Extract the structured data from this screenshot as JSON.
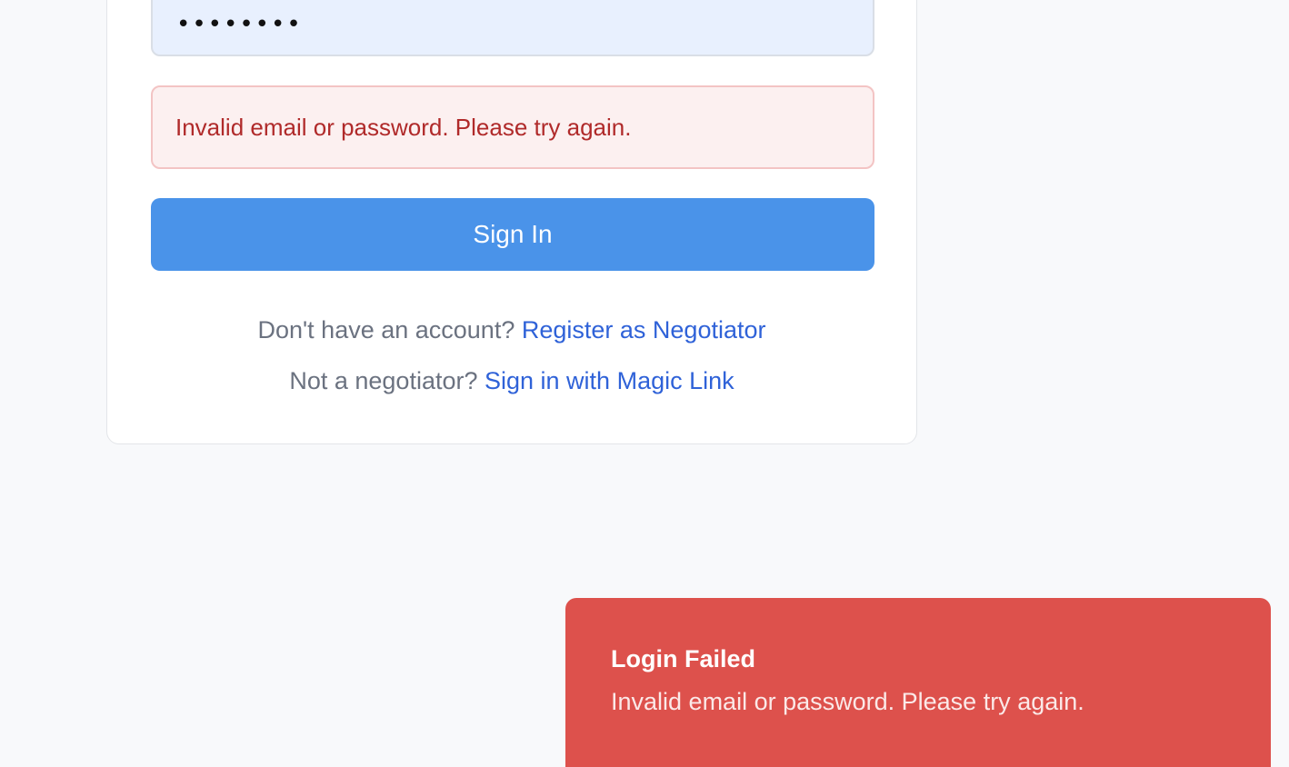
{
  "login_form": {
    "password_value": "••••••••",
    "error_message": "Invalid email or password. Please try again.",
    "signin_label": "Sign In",
    "register_prompt": "Don't have an account?",
    "register_link": "Register as Negotiator",
    "magic_prompt": "Not a negotiator?",
    "magic_link": "Sign in with Magic Link"
  },
  "toast": {
    "title": "Login Failed",
    "message": "Invalid email or password. Please try again."
  },
  "colors": {
    "primary": "#4a93e9",
    "link": "#2f62d8",
    "error_text": "#b02a2a",
    "toast_bg": "#dd514c"
  }
}
